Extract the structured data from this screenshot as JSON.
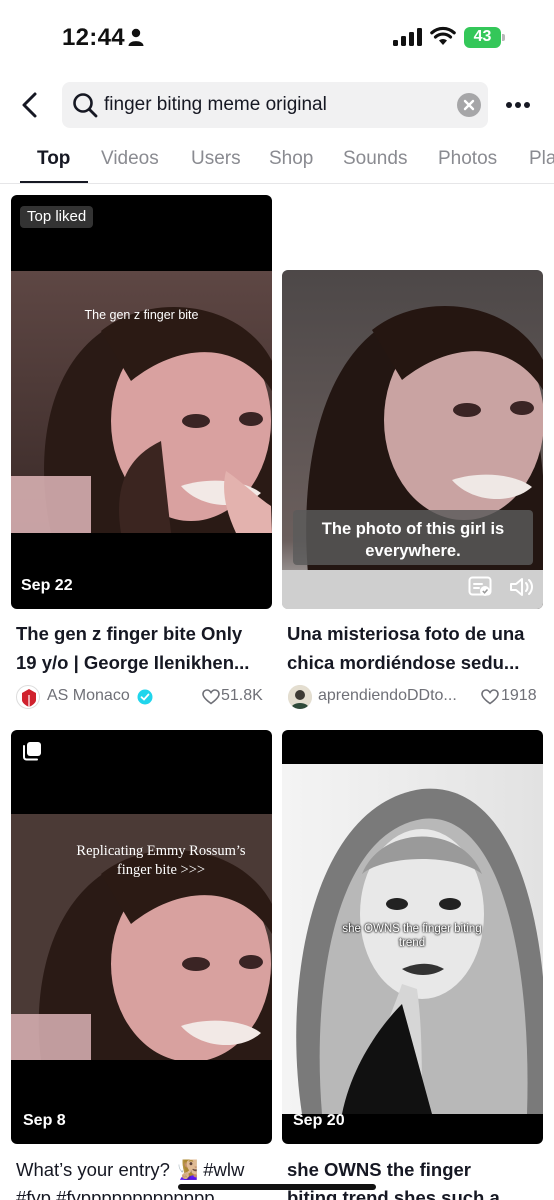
{
  "status_bar": {
    "time": "12:44",
    "battery": "43"
  },
  "search": {
    "query": "finger biting meme original"
  },
  "tabs": [
    {
      "label": "Top"
    },
    {
      "label": "Videos"
    },
    {
      "label": "Users"
    },
    {
      "label": "Shop"
    },
    {
      "label": "Sounds"
    },
    {
      "label": "Photos"
    },
    {
      "label": "Pla"
    }
  ],
  "active_tab": "Top",
  "cards": [
    {
      "badge": "Top liked",
      "overlay_text": "The gen z finger bite",
      "date": "Sep 22",
      "title_line1": "The gen z finger bite Only",
      "title_line2": "19 y/o | George Ilenikhen...",
      "author": "AS Monaco",
      "likes": "51.8K"
    },
    {
      "overlay_text": "The photo of this girl is everywhere.",
      "title_line1": "Una misteriosa foto de una",
      "title_line2": "chica mordiéndose sedu...",
      "author": "aprendiendoDDto...",
      "likes": "1918"
    },
    {
      "overlay_text": "Replicating Emmy Rossum’s  finger bite >>>",
      "date": "Sep 8",
      "title_line1": "What’s your entry? 🧏🏼‍♀️ #wlw",
      "title_line2": "#fyp #fyppppppppppppp..."
    },
    {
      "overlay_text": "she OWNS the finger biting trend",
      "date": "Sep 20",
      "title_line1": "she OWNS the finger",
      "title_line2": "biting trend shes such a..."
    }
  ],
  "colors": {
    "accent": "#161823",
    "verified": "#20d5ec",
    "battery": "#34c759"
  },
  "icons": [
    "person-icon",
    "signal-icon",
    "wifi-icon",
    "back-arrow-icon",
    "search-icon",
    "clear-icon",
    "more-icon",
    "verified-icon",
    "heart-icon",
    "captions-icon",
    "speaker-icon",
    "multi-photo-icon"
  ]
}
